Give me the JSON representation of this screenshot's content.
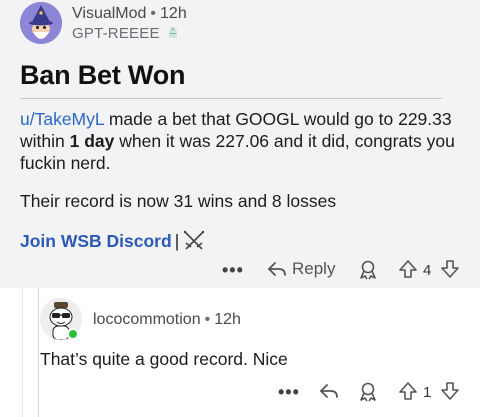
{
  "post": {
    "author": "VisualMod",
    "time": "12h",
    "flair": "GPT-REEEE",
    "title": "Ban Bet Won",
    "body_user": "u/TakeMyL",
    "body_part1": " made a bet that GOOGL would go to 229.33 within ",
    "body_bold": "1 day",
    "body_part2": " when it was 227.06 and it did, congrats you fuckin nerd.",
    "record_text": "Their record is now 31 wins and 8 losses",
    "discord_link": "Join WSB Discord",
    "discord_sep": "|",
    "more": "•••",
    "reply_label": "Reply",
    "score": "4",
    "icons": {
      "avatar": "wizard-avatar-icon",
      "flair": "flair-icon",
      "discord": "crossed-swords-icon",
      "reply": "reply-arrow-icon",
      "award": "award-icon",
      "upvote": "upvote-arrow-icon",
      "downvote": "downvote-arrow-icon"
    }
  },
  "reply": {
    "author": "lococommotion",
    "time": "12h",
    "body": "That’s quite a good record. Nice",
    "more": "•••",
    "score": "1"
  },
  "colors": {
    "link": "#2a67c9",
    "discord": "#2a59b7",
    "card_bg": "#f3f3f5",
    "online": "#2ebd3a"
  }
}
